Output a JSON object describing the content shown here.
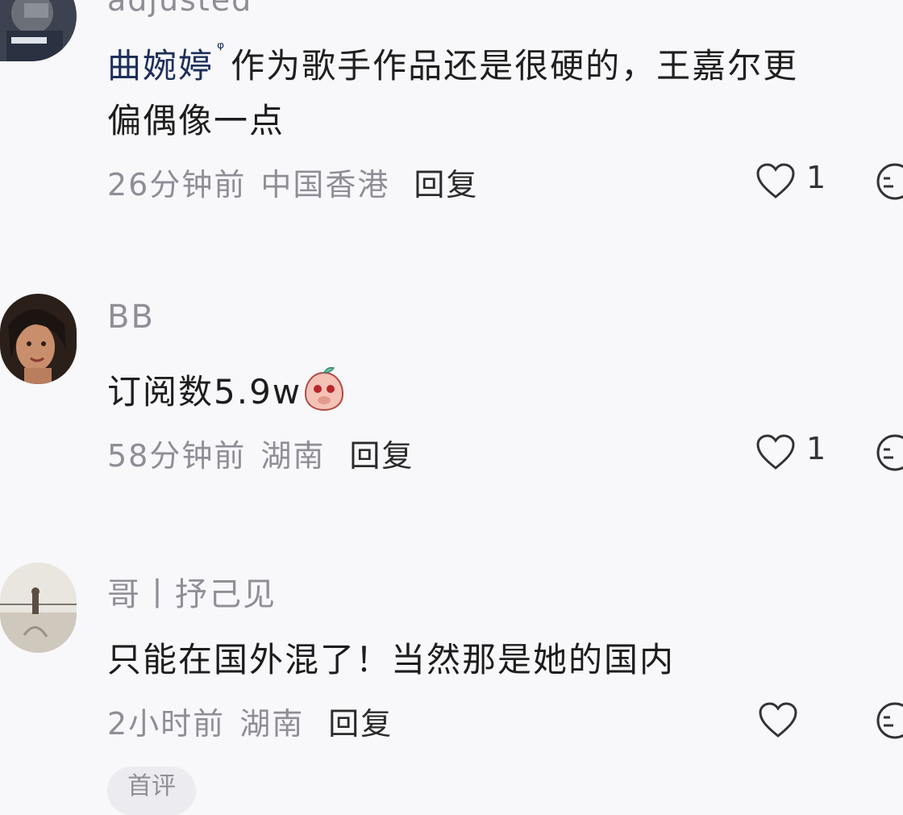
{
  "top_partial_text": "adjusted",
  "comments": [
    {
      "username": "曲婉婷",
      "badge": "ᵠ",
      "text_line1": "作为歌手作品还是很硬的，王嘉尔更",
      "text_line2": "偏偶像一点",
      "time": "26分钟前",
      "location": "中国香港",
      "reply": "回复",
      "likes": "1"
    },
    {
      "username": "BB",
      "text": "订阅数5.9w",
      "time": "58分钟前",
      "location": "湖南",
      "reply": "回复",
      "likes": "1"
    },
    {
      "username": "哥丨抒己见",
      "text": "只能在国外混了！当然那是她的国内",
      "time": "2小时前",
      "location": "湖南",
      "reply": "回复",
      "likes": ""
    }
  ],
  "bottom_pill": "首评",
  "icons": {
    "like": "heart-outline-icon",
    "emoji": "emoji-face-icon",
    "sticker": "peach-sticker-icon"
  },
  "colors": {
    "background": "#f8f8fb",
    "username": "#1d2f5a",
    "meta": "#8e8e96"
  }
}
